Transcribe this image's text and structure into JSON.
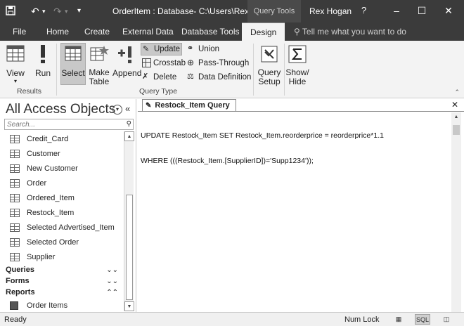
{
  "titlebar": {
    "title": "OrderItem : Database- C:\\Users\\Rex\\Docu...",
    "context_tab": "Query Tools",
    "user": "Rex Hogan",
    "help": "?",
    "minimize": "–",
    "restore": "☐",
    "close": "✕"
  },
  "tabs": {
    "file": "File",
    "home": "Home",
    "create": "Create",
    "external": "External Data",
    "dbtools": "Database Tools",
    "design": "Design",
    "tellme": "Tell me what you want to do"
  },
  "ribbon": {
    "results": {
      "view": "View",
      "run": "Run",
      "group": "Results"
    },
    "query_type": {
      "select": "Select",
      "make_table": "Make Table",
      "append": "Append",
      "update": "Update",
      "crosstab": "Crosstab",
      "delete": "Delete",
      "union": "Union",
      "pass_through": "Pass-Through",
      "data_definition": "Data Definition",
      "group": "Query Type"
    },
    "query_setup": "Query Setup",
    "show_hide": "Show/ Hide"
  },
  "nav": {
    "title": "All Access Objects",
    "collapse": "«",
    "search_placeholder": "Search...",
    "tables": [
      "Credit_Card",
      "Customer",
      "New Customer",
      "Order",
      "Ordered_Item",
      "Restock_Item",
      "Selected Advertised_Item",
      "Selected Order",
      "Supplier"
    ],
    "groups": {
      "queries": "Queries",
      "forms": "Forms",
      "reports": "Reports"
    },
    "reports": [
      "Order Items"
    ]
  },
  "document": {
    "tab_label": "Restock_Item Query",
    "close": "✕",
    "sql_line1": "UPDATE Restock_Item SET Restock_Item.reorderprice = reorderprice*1.1",
    "sql_line2": "WHERE (((Restock_Item.[SupplierID])='Supp1234'));"
  },
  "status": {
    "ready": "Ready",
    "numlock": "Num Lock",
    "sql_view": "SQL"
  }
}
